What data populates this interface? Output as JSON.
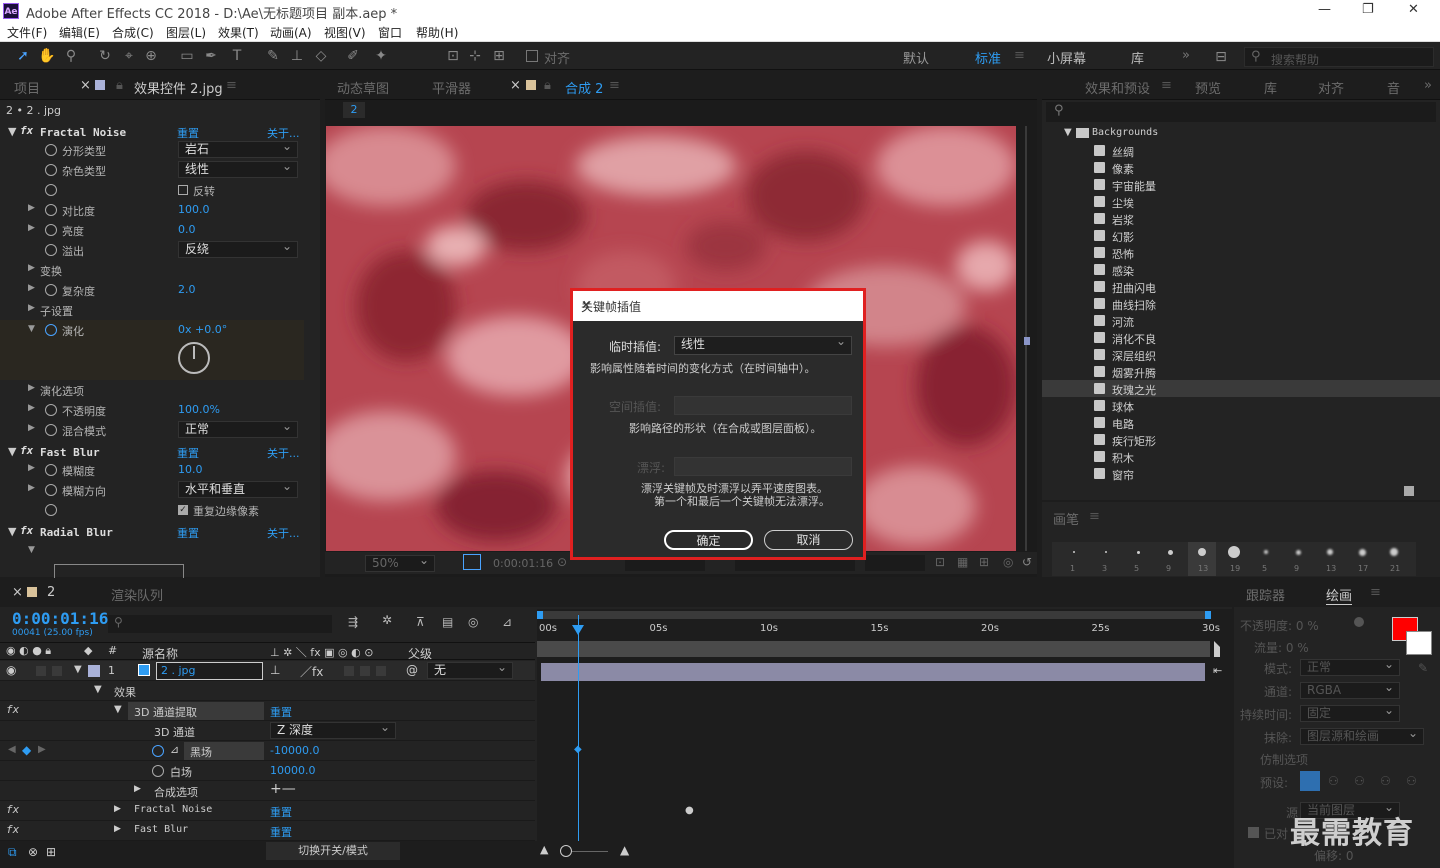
{
  "window": {
    "title": "Adobe After Effects CC 2018 - D:\\Ae\\无标题项目 副本.aep *",
    "logo": "Ae"
  },
  "menu": [
    "文件(F)",
    "编辑(E)",
    "合成(C)",
    "图层(L)",
    "效果(T)",
    "动画(A)",
    "视图(V)",
    "窗口",
    "帮助(H)"
  ],
  "toolbar": {
    "snap_label": "对齐",
    "workspaces": [
      "默认",
      "标准",
      "小屏幕",
      "库"
    ],
    "search_placeholder": "搜索帮助"
  },
  "left_panel": {
    "tabs": [
      "项目",
      "效果控件 2.jpg"
    ],
    "layer": "2 • 2 . jpg",
    "effects": [
      {
        "name": "Fractal Noise",
        "reset": "重置",
        "about": "关于..."
      },
      {
        "name": "Fast Blur",
        "reset": "重置",
        "about": "关于..."
      },
      {
        "name": "Radial Blur",
        "reset": "重置",
        "about": "关于..."
      }
    ],
    "fractal": {
      "fractal_type": {
        "label": "分形类型",
        "value": "岩石"
      },
      "noise_type": {
        "label": "杂色类型",
        "value": "线性"
      },
      "invert": "反转",
      "contrast": {
        "label": "对比度",
        "value": "100.0"
      },
      "brightness": {
        "label": "亮度",
        "value": "0.0"
      },
      "overflow": {
        "label": "溢出",
        "value": "反绕"
      },
      "transform": "变换",
      "complexity": {
        "label": "复杂度",
        "value": "2.0"
      },
      "sub_settings": "子设置",
      "evolution": {
        "label": "演化",
        "value": "0x +0.0°"
      },
      "evolution_options": "演化选项",
      "opacity": {
        "label": "不透明度",
        "value": "100.0%"
      },
      "blend_mode": {
        "label": "混合模式",
        "value": "正常"
      }
    },
    "fastblur": {
      "blurriness": {
        "label": "模糊度",
        "value": "10.0"
      },
      "direction": {
        "label": "模糊方向",
        "value": "水平和垂直"
      },
      "repeat": "重复边缘像素"
    }
  },
  "viewer": {
    "tabs": [
      "动态草图",
      "平滑器",
      "合成 2"
    ],
    "comp_tab": "2",
    "zoom": "50%",
    "timecode": "0:00:01:16"
  },
  "dialog": {
    "title": "关键帧插值",
    "temporal_label": "临时插值:",
    "temporal_value": "线性",
    "temporal_desc": "影响属性随着时间的变化方式（在时间轴中）。",
    "spatial_label": "空间插值:",
    "spatial_desc": "影响路径的形状（在合成或图层面板）。",
    "roving_label": "漂浮:",
    "roving_desc1": "漂浮关键帧及时漂浮以弄平速度图表。",
    "roving_desc2": "第一个和最后一个关键帧无法漂浮。",
    "ok": "确定",
    "cancel": "取消"
  },
  "effects_presets": {
    "tabs": [
      "效果和预设",
      "预览",
      "库",
      "对齐",
      "音"
    ],
    "folder": "Backgrounds",
    "items": [
      "丝绸",
      "像素",
      "宇宙能量",
      "尘埃",
      "岩浆",
      "幻影",
      "恐怖",
      "感染",
      "扭曲闪电",
      "曲线扫除",
      "河流",
      "消化不良",
      "深层组织",
      "烟雾升腾",
      "玫瑰之光",
      "球体",
      "电路",
      "疾行矩形",
      "积木",
      "窗帘"
    ],
    "selected": "玫瑰之光"
  },
  "brushes": {
    "title": "画笔",
    "sizes": [
      "1",
      "3",
      "5",
      "9",
      "13",
      "19",
      "5",
      "9",
      "13",
      "17",
      "21"
    ]
  },
  "timeline": {
    "tabs": [
      "2",
      "渲染队列"
    ],
    "timecode": "0:00:01:16",
    "frames": "00041 (25.00 fps)",
    "col_source": "源名称",
    "col_parent": "父级",
    "layer_num": "1",
    "layer_name": "2 . jpg",
    "parent_value": "无",
    "effects_group": "效果",
    "channel_extract": {
      "name": "3D 通道提取",
      "reset": "重置"
    },
    "channel": {
      "label": "3D 通道",
      "value": "Z 深度"
    },
    "black": {
      "label": "黑场",
      "value": "-10000.0"
    },
    "white": {
      "label": "白场",
      "value": "10000.0"
    },
    "composite": "合成选项",
    "fractal_row": {
      "name": "Fractal Noise",
      "reset": "重置"
    },
    "fastblur_row": {
      "name": "Fast Blur",
      "reset": "重置"
    },
    "toggle": "切换开关/模式",
    "ruler": [
      "00s",
      "05s",
      "10s",
      "15s",
      "20s",
      "25s",
      "30s"
    ]
  },
  "right_tools": {
    "tabs": [
      "跟踪器",
      "绘画"
    ],
    "opacity": "不透明度: 0 %",
    "flow": "流量: 0 %",
    "mode_label": "模式:",
    "mode_value": "正常",
    "channel_label": "通道:",
    "channel_value": "RGBA",
    "duration_label": "持续时间:",
    "duration_value": "固定",
    "erase_label": "抹除:",
    "erase_value": "图层源和绘画",
    "clone_options": "仿制选项",
    "preset_label": "预设:",
    "source_label": "源",
    "source_value": "当前图层",
    "aligned": "已对",
    "offset": "偏移: 0",
    "fg_color": "#ff0000",
    "bg_color": "#ffffff"
  },
  "watermark": "最需教育"
}
